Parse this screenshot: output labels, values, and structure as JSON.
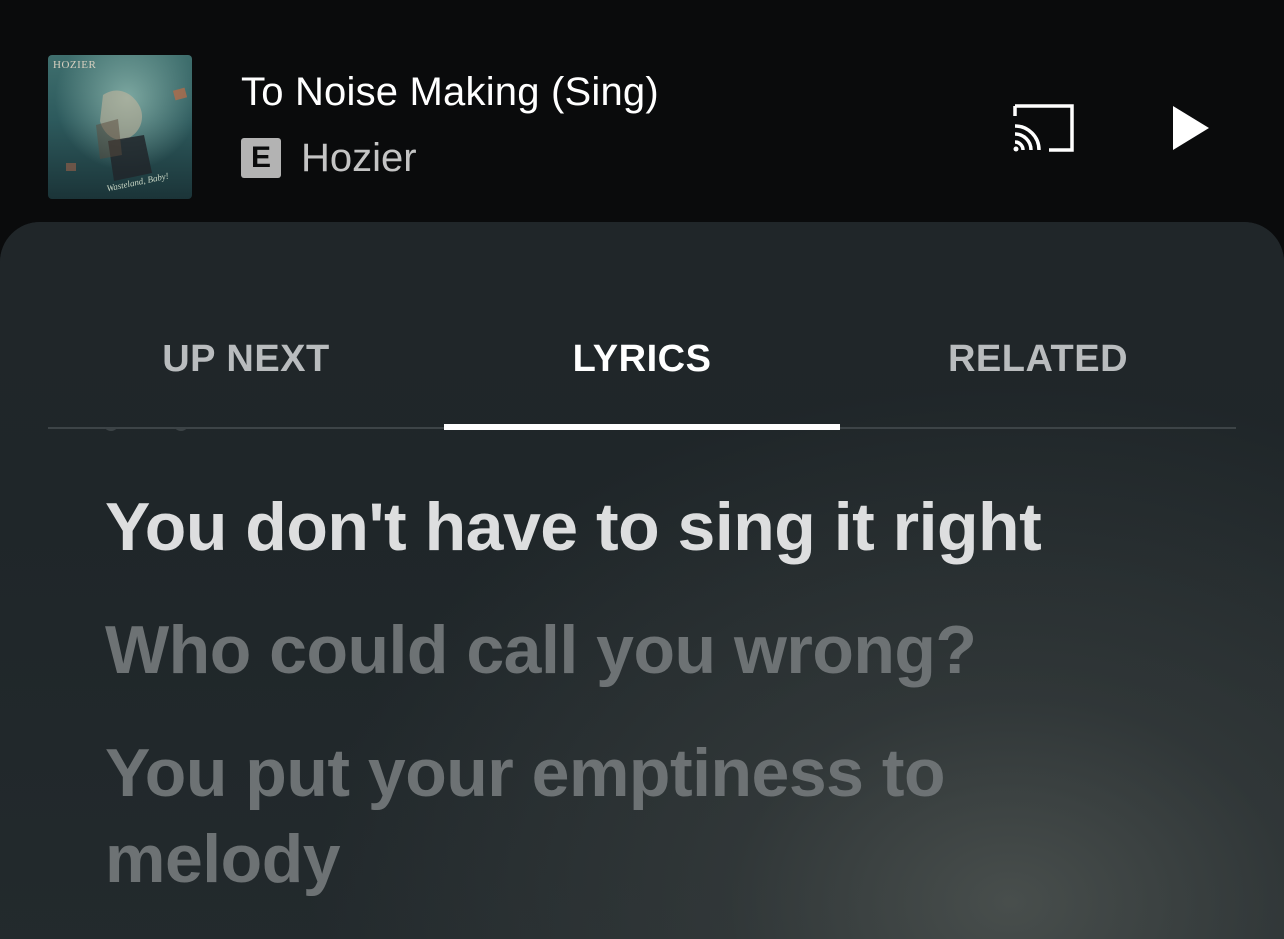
{
  "player": {
    "track_title": "To Noise Making (Sing)",
    "explicit_badge": "E",
    "artist": "Hozier",
    "album_art_text": "HOZIER",
    "album_art_signature": "Wasteland, Baby!",
    "cast_icon": "cast-icon",
    "play_icon": "play-icon"
  },
  "tabs": [
    {
      "label": "UP NEXT",
      "active": false
    },
    {
      "label": "LYRICS",
      "active": true
    },
    {
      "label": "RELATED",
      "active": false
    }
  ],
  "lyrics": [
    {
      "text": "You don't have to sing it right",
      "state": "current"
    },
    {
      "text": "Who could call you wrong?",
      "state": "upcoming"
    },
    {
      "text": "You put your emptiness to melody",
      "state": "upcoming"
    }
  ],
  "colors": {
    "background": "#0a0b0c",
    "sheet": "#1d2226",
    "active_tab": "#ffffff",
    "inactive_tab": "#b9bcbe",
    "current_lyric": "#dddedf",
    "upcoming_lyric": "#6d7274"
  }
}
